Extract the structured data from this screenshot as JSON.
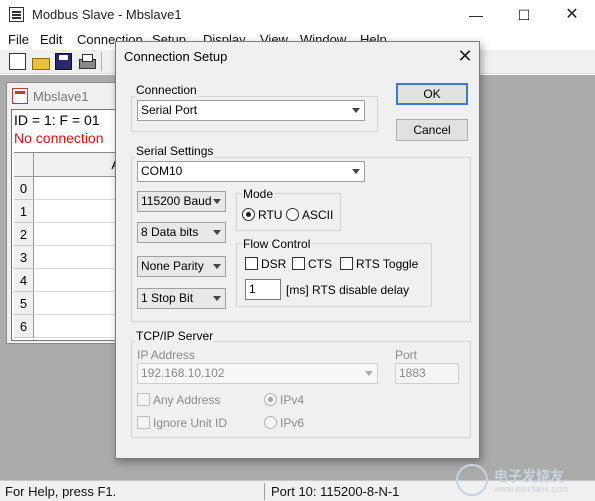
{
  "window": {
    "title": "Modbus Slave - Mbslave1",
    "minimize_glyph": "—",
    "maximize_glyph": "☐",
    "close_glyph": "✕"
  },
  "menu": [
    "File",
    "Edit",
    "Connection",
    "Setup",
    "Display",
    "View",
    "Window",
    "Help"
  ],
  "toolbar": {
    "icons": [
      "new-icon",
      "open-icon",
      "save-icon",
      "print-icon"
    ]
  },
  "child": {
    "title": "Mbslave1",
    "id_line": "ID = 1: F = 01",
    "status": "No connection",
    "status_color": "#e01010",
    "column_header": "A",
    "rows": [
      "0",
      "1",
      "2",
      "3",
      "4",
      "5",
      "6"
    ]
  },
  "dialog": {
    "title": "Connection Setup",
    "close_glyph": "✕",
    "ok_label": "OK",
    "cancel_label": "Cancel",
    "connection": {
      "label": "Connection",
      "value": "Serial Port"
    },
    "serial": {
      "label": "Serial Settings",
      "port": "COM10",
      "baud": "115200 Baud",
      "data_bits": "8 Data bits",
      "parity": "None Parity",
      "stop_bits": "1 Stop Bit"
    },
    "mode": {
      "label": "Mode",
      "rtu": "RTU",
      "ascii": "ASCII",
      "selected": "RTU"
    },
    "flow": {
      "label": "Flow Control",
      "dsr": "DSR",
      "cts": "CTS",
      "rts_toggle": "RTS Toggle",
      "delay_value": "1",
      "delay_label": "[ms] RTS disable delay"
    },
    "tcp": {
      "label": "TCP/IP Server",
      "ip_label": "IP Address",
      "ip_value": "192.168.10.102",
      "port_label": "Port",
      "port_value": "1883",
      "any_address": "Any Address",
      "ignore_unit": "Ignore Unit ID",
      "ipv4": "IPv4",
      "ipv6": "IPv6"
    }
  },
  "statusbar": {
    "left": "For Help, press F1.",
    "right": "Port 10: 115200-8-N-1"
  },
  "watermark": {
    "text": "电子发烧友",
    "sub": "www.elecfans.com"
  },
  "colors": {
    "default_button_border": "#3c78d8",
    "error_text": "#e01010",
    "mdi_background": "#ababab"
  }
}
